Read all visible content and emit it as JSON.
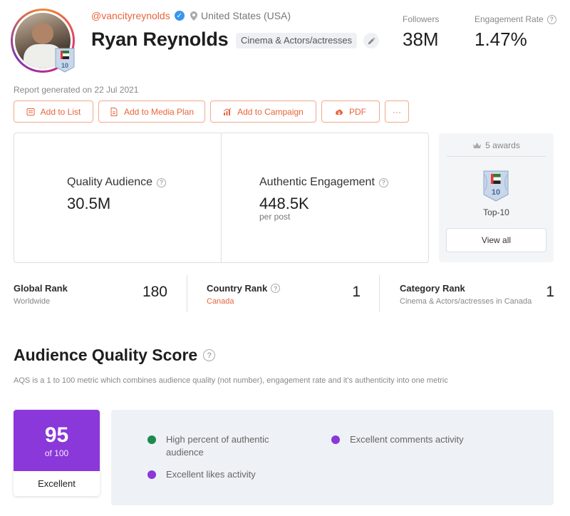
{
  "profile": {
    "handle": "@vancityreynolds",
    "location": "United States (USA)",
    "name": "Ryan Reynolds",
    "category": "Cinema & Actors/actresses",
    "badge_rank": "10"
  },
  "stats": {
    "followers_label": "Followers",
    "followers_value": "38M",
    "engagement_label": "Engagement Rate",
    "engagement_value": "1.47%"
  },
  "report_date": "Report generated on 22 Jul 2021",
  "actions": {
    "add_to_list": "Add to List",
    "add_to_media_plan": "Add to Media Plan",
    "add_to_campaign": "Add to Campaign",
    "pdf": "PDF",
    "more": "···"
  },
  "metrics": {
    "quality_audience_label": "Quality Audience",
    "quality_audience_value": "30.5M",
    "authentic_engagement_label": "Authentic Engagement",
    "authentic_engagement_value": "448.5K",
    "authentic_engagement_sub": "per post"
  },
  "awards": {
    "title": "5 awards",
    "badge_number": "10",
    "name": "Top-10",
    "view_all": "View all"
  },
  "ranks": [
    {
      "title": "Global Rank",
      "sub": "Worldwide",
      "value": "180"
    },
    {
      "title": "Country Rank",
      "sub": "Canada",
      "value": "1"
    },
    {
      "title": "Category Rank",
      "sub": "Cinema & Actors/actresses in Canada",
      "value": "1"
    }
  ],
  "aqs": {
    "title": "Audience Quality Score",
    "description": "AQS is a 1 to 100 metric which combines audience quality (not number), engagement rate and it's authenticity into one metric",
    "score": "95",
    "score_of": "of 100",
    "grade": "Excellent",
    "items": [
      {
        "text": "High percent of authentic audience",
        "color": "#1e8a4f"
      },
      {
        "text": "Excellent comments activity",
        "color": "#8a38d9"
      },
      {
        "text": "Excellent likes activity",
        "color": "#8a38d9"
      }
    ]
  },
  "colors": {
    "accent": "#e8643c",
    "score_purple": "#8a38d9",
    "verified_blue": "#3897f0"
  }
}
